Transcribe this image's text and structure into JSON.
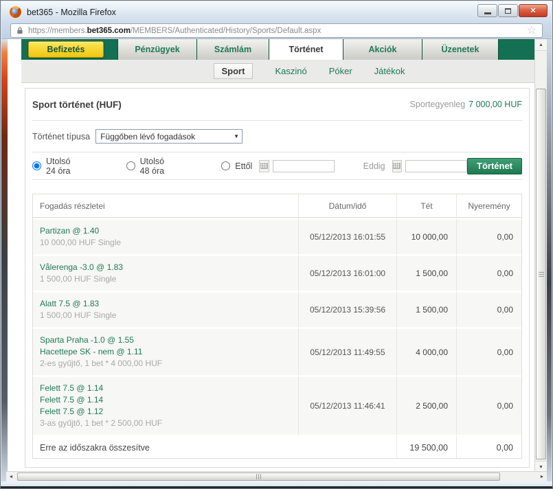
{
  "colors": {
    "brand_green": "#137052",
    "accent_yellow": "#efc50f",
    "link_green": "#1c7a55",
    "balance_green": "#1c7a55",
    "close_button_red": "#c23a22"
  },
  "window": {
    "title": "bet365 - Mozilla Firefox",
    "url_prefix": "https://members.",
    "url_domain": "bet365.com",
    "url_path": "/MEMBERS/Authenticated/History/Sports/Default.aspx"
  },
  "nav": {
    "tabs": [
      {
        "label": "Befizetés"
      },
      {
        "label": "Pénzügyek"
      },
      {
        "label": "Számlám"
      },
      {
        "label": "Történet",
        "active": true
      },
      {
        "label": "Akciók"
      },
      {
        "label": "Üzenetek"
      }
    ],
    "subtabs": [
      {
        "label": "Sport",
        "active": true
      },
      {
        "label": "Kaszinó"
      },
      {
        "label": "Póker"
      },
      {
        "label": "Játékok"
      }
    ]
  },
  "page": {
    "title": "Sport történet (HUF)",
    "balance_label": "Sportegyenleg",
    "balance_value": "7 000,00 HUF",
    "history_type_label": "Történet típusa",
    "history_type_value": "Függőben lévő fogadások",
    "radio_24h_label": "Utolsó 24 óra",
    "radio_48h_label": "Utolsó 48 óra",
    "from_label": "Ettől",
    "to_label": "Eddig",
    "from_value": "",
    "to_value": "",
    "history_button_label": "Történet"
  },
  "table": {
    "headers": [
      "Fogadás részletei",
      "Dátum/idő",
      "Tét",
      "Nyeremény"
    ],
    "rows": [
      {
        "selections": [
          "Partizan @ 1.40"
        ],
        "details": "10 000,00 HUF  Single",
        "datetime": "05/12/2013 16:01:55",
        "stake": "10 000,00",
        "returns": "0,00"
      },
      {
        "selections": [
          "Vålerenga  -3.0 @ 1.83"
        ],
        "details": "1 500,00 HUF  Single",
        "datetime": "05/12/2013 16:01:00",
        "stake": "1 500,00",
        "returns": "0,00"
      },
      {
        "selections": [
          "Alatt 7.5 @ 1.83"
        ],
        "details": "1 500,00 HUF  Single",
        "datetime": "05/12/2013 15:39:56",
        "stake": "1 500,00",
        "returns": "0,00"
      },
      {
        "selections": [
          "Sparta Praha  -1.0 @ 1.55",
          "Hacettepe SK - nem @ 1.11"
        ],
        "details": "2-es gyűjtő, 1  bet * 4 000,00 HUF",
        "datetime": "05/12/2013 11:49:55",
        "stake": "4 000,00",
        "returns": "0,00"
      },
      {
        "selections": [
          "Felett 7.5 @ 1.14",
          "Felett 7.5 @ 1.14",
          "Felett 7.5 @ 1.12"
        ],
        "details": "3-as gyűjtő, 1  bet * 2 500,00 HUF",
        "datetime": "05/12/2013 11:46:41",
        "stake": "2 500,00",
        "returns": "0,00"
      }
    ],
    "footer": {
      "label": "Erre az időszakra összesítve",
      "stake": "19 500,00",
      "returns": "0,00"
    }
  }
}
